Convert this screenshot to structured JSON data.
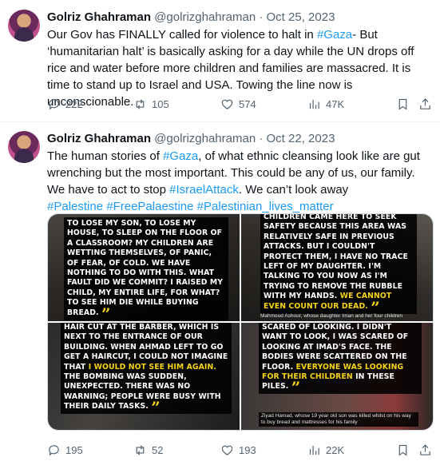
{
  "tweets": [
    {
      "name": "Golriz Ghahraman",
      "handle": "@golrizghahraman",
      "date": "Oct 25, 2023",
      "text_parts": {
        "a": "Our Gov has FINALLY called for violence to halt in ",
        "hashtag": "#Gaza",
        "b": "- But ‘humanitarian halt’ is basically asking for a day while the UN drops off rice and water before more children and families are massacred. It is time to stand up to Israel and USA. Towing the line now is unconscionable."
      },
      "stats": {
        "replies": "222",
        "reposts": "105",
        "likes": "574",
        "views": "47K"
      }
    },
    {
      "name": "Golriz Ghahraman",
      "handle": "@golrizghahraman",
      "date": "Oct 22, 2023",
      "text_parts": {
        "a": "The human stories of ",
        "hashtag1": "#Gaza",
        "b": ", of what ethnic cleansing look like are gut wrenching but the most important. This could be any of us, our family. We have to act to stop ",
        "hashtag2": "#IsraelAttack",
        "c": ". We can’t look away",
        "hashtag3": "#Palestine",
        "hashtag4": "#FreePalaestine",
        "hashtag5": "#Palestinian_lives_matter"
      },
      "media": {
        "panel1": {
          "text": "to lose my son, to lose my house, to sleep on the floor of a classroom? My children are wetting themselves, of panic, of fear, of cold. We have nothing to do with this. What fault did we commit? I raised my child, my entire life, for what? To see him die while buying bread."
        },
        "panel2": {
          "text": "children came here to seek safety because this area was relatively safe in previous attacks. But I couldn't protect them, I have no trace left of my daughter. I'm talking to you now as I'm trying to remove the rubble with my hands.",
          "highlight": "We cannot even count our dead.",
          "small": "Mahmoud Ashour, whose daughter Iman and her four children"
        },
        "panel3": {
          "text_a": "hair cut at the barber, which is next to the entrance of our building. When Ahmad left to go get a haircut, I could not imagine that ",
          "highlight": "I would not see him again.",
          "text_b": " The bombing was sudden, unexpected. There was no warning; people were busy with their daily tasks."
        },
        "panel4": {
          "text_a": "scared of looking. I didn't want to look, I was scared of looking at Imad's face. The bodies were scattered on the floor. ",
          "highlight": "Everyone was looking for their children",
          "text_b": " in these piles.",
          "small": "Ziyad Hamad, whose 19 year old son was killed whilst on his way to buy bread and mattresses for his family"
        }
      },
      "stats": {
        "replies": "195",
        "reposts": "52",
        "likes": "193",
        "views": "22K"
      }
    }
  ],
  "quote_mark": "”",
  "separator": "·",
  "colors": {
    "link": "#1d9bf0",
    "text": "#0f1419",
    "muted": "#536471",
    "highlight": "#f5d317"
  },
  "icons": [
    "reply-icon",
    "repost-icon",
    "like-icon",
    "views-icon",
    "bookmark-icon",
    "share-icon"
  ]
}
